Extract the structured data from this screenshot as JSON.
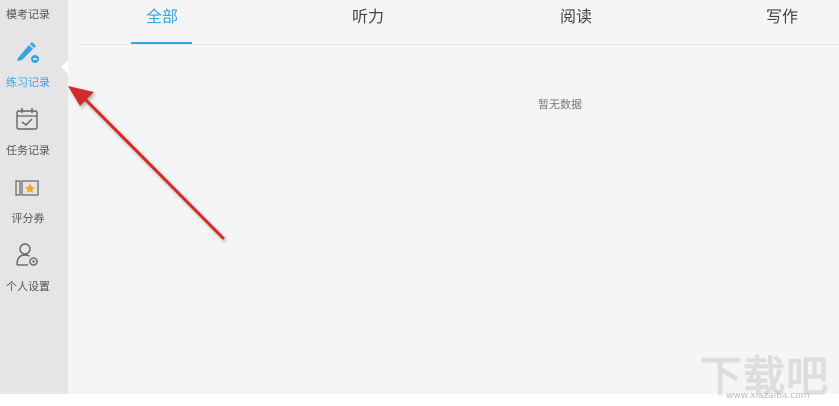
{
  "sidebar": {
    "items": [
      {
        "label": "模考记录",
        "icon": "mock-exam-icon"
      },
      {
        "label": "练习记录",
        "icon": "pencil-icon",
        "active": true
      },
      {
        "label": "任务记录",
        "icon": "calendar-check-icon"
      },
      {
        "label": "评分券",
        "icon": "star-ticket-icon"
      },
      {
        "label": "个人设置",
        "icon": "user-settings-icon"
      }
    ]
  },
  "tabs": [
    {
      "label": "全部",
      "active": true
    },
    {
      "label": "听力"
    },
    {
      "label": "阅读"
    },
    {
      "label": "写作"
    }
  ],
  "empty_state": "暂无数据",
  "watermark": {
    "logo": "下载吧",
    "url": "www.xiazaiba.com"
  },
  "colors": {
    "accent": "#3aa3e3",
    "sidebar_bg": "#e5e5e5",
    "content_bg": "#f5f5f5",
    "arrow": "#d42a2a"
  }
}
